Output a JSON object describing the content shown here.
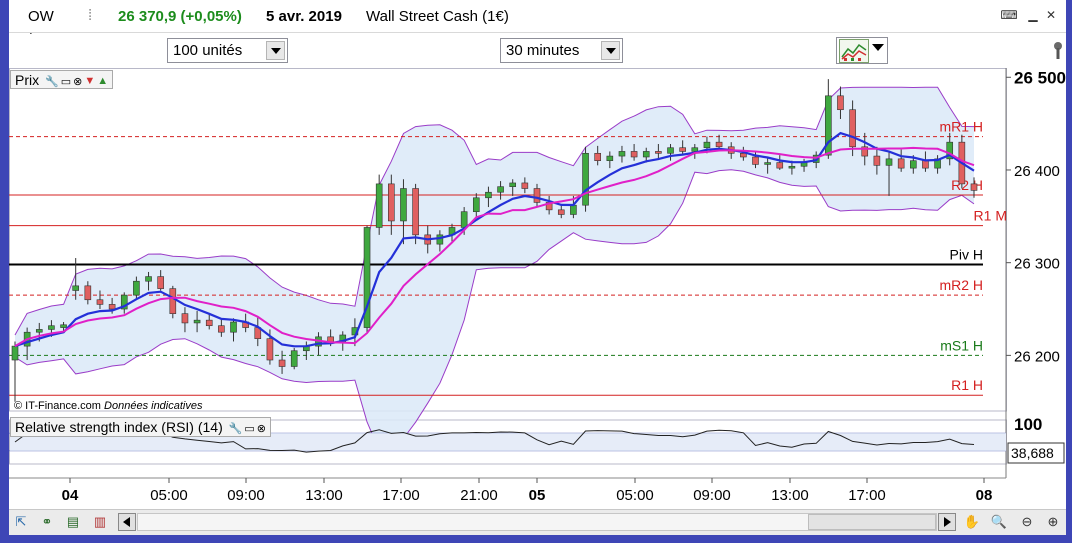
{
  "title": {
    "ticker": "OW",
    "price_change": "26 370,9 (+0,05%)",
    "date": "5 avr. 2019",
    "instrument": "Wall Street Cash (1€)"
  },
  "toolbar": {
    "units": "100 unités",
    "timeframe": "30 minutes"
  },
  "price_panel": {
    "legend": "Prix",
    "watermark_source": "© IT-Finance.com",
    "watermark_note": "Données indicatives",
    "y_axis_labels": [
      "26 500",
      "26 400",
      "26 300",
      "26 200"
    ],
    "levels": [
      {
        "label": "mR1 H",
        "value": 26436,
        "color": "#d42020",
        "style": "dashed"
      },
      {
        "label": "R2 H",
        "value": 26373,
        "color": "#d42020",
        "style": "solid"
      },
      {
        "label": "R1 M",
        "value": 26340,
        "color": "#d42020",
        "style": "solid"
      },
      {
        "label": "Piv H",
        "value": 26298,
        "color": "#000000",
        "style": "solid"
      },
      {
        "label": "mR2 H",
        "value": 26265,
        "color": "#d42020",
        "style": "dashed"
      },
      {
        "label": "mS1 H",
        "value": 26200,
        "color": "#1a7a1a",
        "style": "dashed"
      },
      {
        "label": "R1 H",
        "value": 26157,
        "color": "#d42020",
        "style": "solid"
      }
    ]
  },
  "rsi_panel": {
    "legend": "Relative strength index (RSI) (14)",
    "top_label": "100",
    "value_label": "38,688"
  },
  "x_axis_labels": [
    "04",
    "05:00",
    "09:00",
    "13:00",
    "17:00",
    "21:00",
    "05",
    "05:00",
    "09:00",
    "13:00",
    "17:00",
    "08"
  ],
  "colors": {
    "frame": "#3e46b6",
    "up_candle": "#3fa83f",
    "down_candle": "#e06060",
    "bollinger": "#9a3cc8",
    "ma_fast": "#e020c8",
    "ma_slow": "#2430d8",
    "price_green": "#1c8c1c"
  },
  "icons": {
    "cursor": "arrow-cursor-icon",
    "indicator": "chart-indicator-icon",
    "wrench": "wrench-icon",
    "zoom_in": "zoom-in-icon",
    "zoom_out": "zoom-out-icon"
  },
  "chart_data": {
    "type": "candlestick",
    "ylim": [
      26140,
      26510
    ],
    "candles_ohlc": [
      [
        26195,
        26215,
        26150,
        26210
      ],
      [
        26210,
        26230,
        26195,
        26225
      ],
      [
        26225,
        26235,
        26215,
        26228
      ],
      [
        26228,
        26238,
        26220,
        26232
      ],
      [
        26230,
        26236,
        26225,
        26233
      ],
      [
        26270,
        26305,
        26260,
        26275
      ],
      [
        26275,
        26280,
        26255,
        26260
      ],
      [
        26260,
        26270,
        26250,
        26255
      ],
      [
        26255,
        26262,
        26245,
        26250
      ],
      [
        26250,
        26268,
        26245,
        26265
      ],
      [
        26265,
        26285,
        26260,
        26280
      ],
      [
        26280,
        26290,
        26270,
        26285
      ],
      [
        26285,
        26292,
        26270,
        26272
      ],
      [
        26272,
        26275,
        26240,
        26245
      ],
      [
        26245,
        26252,
        26225,
        26235
      ],
      [
        26235,
        26248,
        26225,
        26238
      ],
      [
        26238,
        26245,
        26228,
        26232
      ],
      [
        26232,
        26240,
        26220,
        26225
      ],
      [
        26225,
        26240,
        26215,
        26236
      ],
      [
        26236,
        26245,
        26225,
        26230
      ],
      [
        26230,
        26242,
        26210,
        26218
      ],
      [
        26218,
        26228,
        26190,
        26195
      ],
      [
        26195,
        26205,
        26180,
        26188
      ],
      [
        26188,
        26208,
        26185,
        26205
      ],
      [
        26205,
        26215,
        26195,
        26210
      ],
      [
        26210,
        26225,
        26200,
        26220
      ],
      [
        26220,
        26228,
        26210,
        26214
      ],
      [
        26214,
        26226,
        26205,
        26222
      ],
      [
        26222,
        26240,
        26210,
        26230
      ],
      [
        26230,
        26340,
        26225,
        26338
      ],
      [
        26338,
        26395,
        26330,
        26385
      ],
      [
        26385,
        26395,
        26330,
        26345
      ],
      [
        26345,
        26390,
        26320,
        26380
      ],
      [
        26380,
        26385,
        26320,
        26330
      ],
      [
        26330,
        26340,
        26310,
        26320
      ],
      [
        26320,
        26335,
        26312,
        26330
      ],
      [
        26330,
        26342,
        26322,
        26338
      ],
      [
        26338,
        26360,
        26330,
        26355
      ],
      [
        26355,
        26375,
        26348,
        26370
      ],
      [
        26370,
        26382,
        26360,
        26376
      ],
      [
        26376,
        26388,
        26368,
        26382
      ],
      [
        26382,
        26390,
        26372,
        26386
      ],
      [
        26386,
        26392,
        26375,
        26380
      ],
      [
        26380,
        26385,
        26360,
        26365
      ],
      [
        26365,
        26372,
        26352,
        26357
      ],
      [
        26357,
        26362,
        26348,
        26352
      ],
      [
        26352,
        26372,
        26348,
        26362
      ],
      [
        26362,
        26425,
        26355,
        26418
      ],
      [
        26418,
        26426,
        26405,
        26410
      ],
      [
        26410,
        26420,
        26402,
        26415
      ],
      [
        26415,
        26426,
        26408,
        26420
      ],
      [
        26420,
        26428,
        26410,
        26414
      ],
      [
        26414,
        26424,
        26408,
        26420
      ],
      [
        26420,
        26428,
        26412,
        26418
      ],
      [
        26418,
        26428,
        26410,
        26424
      ],
      [
        26424,
        26432,
        26416,
        26420
      ],
      [
        26420,
        26428,
        26412,
        26424
      ],
      [
        26424,
        26436,
        26418,
        26430
      ],
      [
        26430,
        26438,
        26420,
        26425
      ],
      [
        26425,
        26430,
        26412,
        26418
      ],
      [
        26418,
        26425,
        26410,
        26414
      ],
      [
        26414,
        26420,
        26402,
        26406
      ],
      [
        26406,
        26414,
        26396,
        26408
      ],
      [
        26408,
        26416,
        26400,
        26402
      ],
      [
        26402,
        26410,
        26395,
        26404
      ],
      [
        26404,
        26412,
        26398,
        26408
      ],
      [
        26408,
        26420,
        26402,
        26416
      ],
      [
        26416,
        26498,
        26412,
        26480
      ],
      [
        26480,
        26490,
        26455,
        26465
      ],
      [
        26465,
        26475,
        26415,
        26425
      ],
      [
        26425,
        26440,
        26405,
        26415
      ],
      [
        26415,
        26425,
        26395,
        26405
      ],
      [
        26405,
        26420,
        26372,
        26412
      ],
      [
        26412,
        26422,
        26398,
        26402
      ],
      [
        26402,
        26416,
        26396,
        26410
      ],
      [
        26410,
        26420,
        26398,
        26402
      ],
      [
        26402,
        26416,
        26396,
        26412
      ],
      [
        26412,
        26440,
        26405,
        26430
      ],
      [
        26430,
        26438,
        26380,
        26385
      ],
      [
        26385,
        26392,
        26370,
        26378
      ]
    ]
  }
}
